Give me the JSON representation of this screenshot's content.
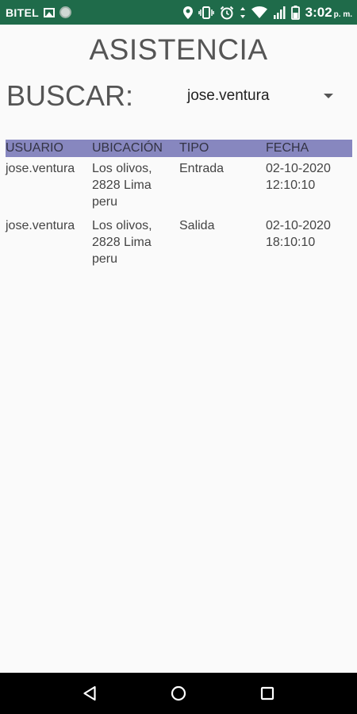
{
  "status_bar": {
    "carrier": "BITEL",
    "time": "3:02",
    "time_suffix": "p. m."
  },
  "header": {
    "title": "ASISTENCIA"
  },
  "search": {
    "label": "BUSCAR:",
    "selected_user": "jose.ventura"
  },
  "table": {
    "headers": [
      "USUARIO",
      "UBICACIÓN",
      "TIPO",
      "FECHA"
    ],
    "rows": [
      {
        "usuario": "jose.ventura",
        "ubicacion": "Los olivos,\n2828 Lima\nperu",
        "tipo": "Entrada",
        "fecha": "02-10-2020\n12:10:10"
      },
      {
        "usuario": "jose.ventura",
        "ubicacion": "Los olivos,\n2828 Lima\nperu",
        "tipo": "Salida",
        "fecha": "02-10-2020\n18:10:10"
      }
    ]
  },
  "colors": {
    "status_bar": "#1f6b4a",
    "table_header": "#8787bf",
    "nav_bar": "#000000"
  }
}
